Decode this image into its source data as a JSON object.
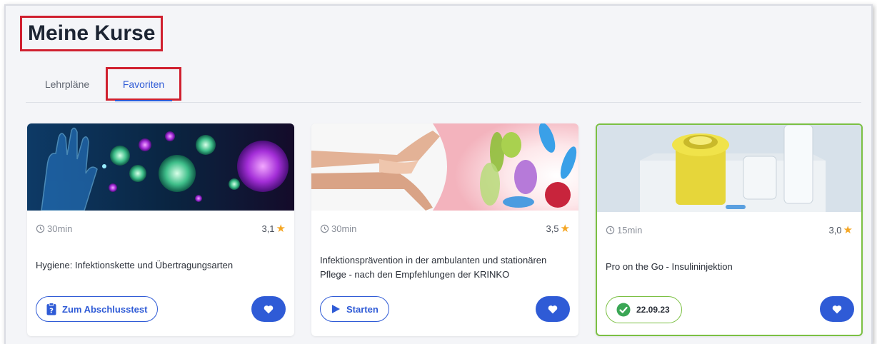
{
  "page": {
    "title": "Meine Kurse"
  },
  "tabs": [
    {
      "label": "Lehrpläne",
      "active": false
    },
    {
      "label": "Favoriten",
      "active": true
    }
  ],
  "colors": {
    "accent": "#2f5bd6",
    "highlight_box": "#d0202f",
    "completed": "#7bc043",
    "star": "#f5a623"
  },
  "courses": [
    {
      "image": "virus-illustration",
      "duration": "30min",
      "rating": "3,1",
      "title": "Hygiene: Infektionskette und Übertragungsarten",
      "action": {
        "type": "button",
        "icon": "clipboard-question-icon",
        "label": "Zum Abschlusstest"
      },
      "favorite": true
    },
    {
      "image": "handwashing-bacteria-illustration",
      "duration": "30min",
      "rating": "3,5",
      "title": "Infektionsprävention in der ambulanten und stationären Pflege - nach den Empfehlungen der KRINKO",
      "action": {
        "type": "button",
        "icon": "play-icon",
        "label": "Starten"
      },
      "favorite": true
    },
    {
      "image": "sharps-container-photo",
      "duration": "15min",
      "rating": "3,0",
      "title": "Pro on the Go - Insulininjektion",
      "action": {
        "type": "completed",
        "icon": "check-circle-icon",
        "label": "22.09.23"
      },
      "favorite": true,
      "completed": true
    }
  ]
}
